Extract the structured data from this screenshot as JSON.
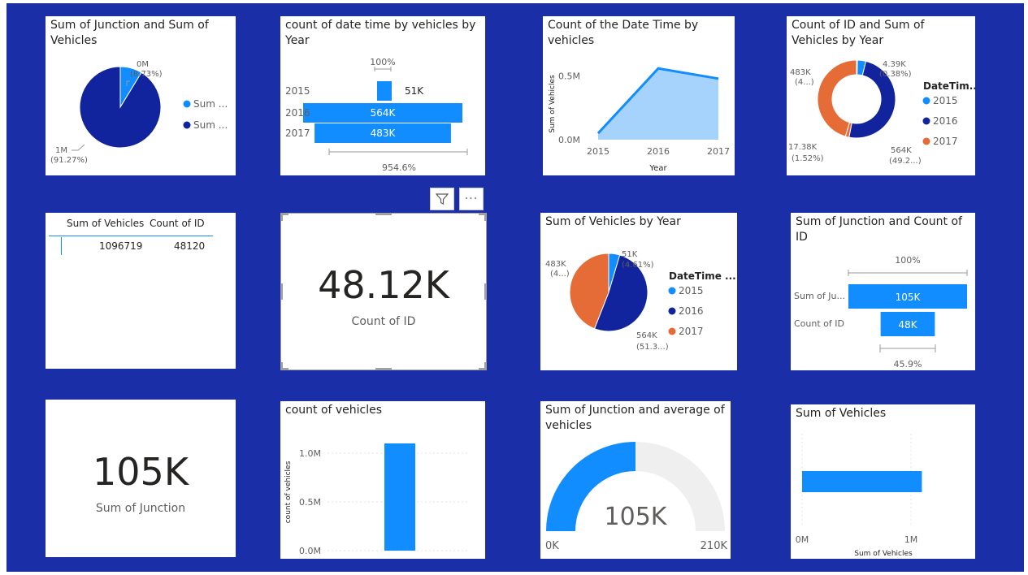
{
  "colors": {
    "canvas": "#1a2ea8",
    "light_blue": "#118dff",
    "dark_blue": "#12239e",
    "orange": "#e66c37",
    "area_fill": "#a6d3fb",
    "gauge_bg": "#efefef",
    "text": "#252423",
    "muted": "#605e5c"
  },
  "icons": {
    "filter": "filter-icon",
    "more": "more-options-icon"
  },
  "tiles": {
    "pie_junction_vehicles": {
      "title": "Sum of Junction and Sum of Vehicles"
    },
    "funnel_year": {
      "title": "count of date time by vehicles by Year"
    },
    "area_datetime": {
      "title": "Count of the Date Time by vehicles"
    },
    "donut_id_vehicles": {
      "title": "Count of ID and Sum of Vehicles by Year"
    },
    "table": {
      "columns": [
        "Sum of Vehicles",
        "Count of ID"
      ],
      "rows": [
        [
          "1096719",
          "48120"
        ]
      ]
    },
    "card_id": {
      "value": "48.12K",
      "label": "Count of ID",
      "more": "···"
    },
    "pie_year": {
      "title": "Sum of Vehicles by Year"
    },
    "funnel_junction_id": {
      "title": "Sum of Junction and Count of ID"
    },
    "card_junction": {
      "value": "105K",
      "label": "Sum of Junction"
    },
    "column_vehicles": {
      "title": "count of vehicles"
    },
    "gauge": {
      "title": "Sum of Junction and average of vehicles"
    },
    "bar_vehicles": {
      "title": "Sum of Vehicles"
    }
  },
  "chart_data": [
    {
      "id": "pie_junction_vehicles",
      "type": "pie",
      "title": "Sum of Junction and Sum of Vehicles",
      "legend_position": "right",
      "legend": [
        "Sum ...",
        "Sum ..."
      ],
      "slices": [
        {
          "value_label": "0M",
          "pct_label": "(8.73%)",
          "fraction": 0.0873,
          "color": "#118dff"
        },
        {
          "value_label": "1M",
          "pct_label": "(91.27%)",
          "fraction": 0.9127,
          "color": "#12239e"
        }
      ]
    },
    {
      "id": "funnel_year",
      "type": "bar",
      "title": "count of date time by vehicles by Year",
      "categories": [
        "2015",
        "2016",
        "2017"
      ],
      "values": [
        51,
        564,
        483
      ],
      "value_labels": [
        "51K",
        "564K",
        "483K"
      ],
      "top_label": "100%",
      "bottom_label": "954.6%",
      "color": "#118dff"
    },
    {
      "id": "area_datetime",
      "type": "area",
      "title": "Count of the Date Time by vehicles",
      "x": [
        "2015",
        "2016",
        "2017"
      ],
      "y": [
        0.05,
        0.56,
        0.48
      ],
      "xlabel": "Year",
      "ylabel": "Sum of Vehicles",
      "y_ticks": [
        "0.0M",
        "0.5M"
      ],
      "y_tick_values": [
        0,
        0.5
      ],
      "ylim": [
        0,
        0.6
      ],
      "grid": false
    },
    {
      "id": "donut_id_vehicles",
      "type": "pie",
      "title": "Count of ID and Sum of Vehicles by Year",
      "legend_title": "DateTim...",
      "legend_position": "right",
      "legend": [
        "2015",
        "2016",
        "2017"
      ],
      "slices": [
        {
          "value_label": "4.39K",
          "pct_label": "(0.38%)",
          "fraction": 0.0038,
          "color": "#118dff"
        },
        {
          "value_label": "",
          "pct_label": "",
          "fraction": 0.035,
          "color": "#118dff"
        },
        {
          "value_label": "564K",
          "pct_label": "(49.2...)",
          "fraction": 0.4922,
          "color": "#12239e"
        },
        {
          "value_label": "17.38K",
          "pct_label": "(1.52%)",
          "fraction": 0.0152,
          "color": "#e66c37"
        },
        {
          "value_label": "483K",
          "pct_label": "(4...)",
          "fraction": 0.4538,
          "color": "#e66c37"
        }
      ]
    },
    {
      "id": "pie_year",
      "type": "pie",
      "title": "Sum of Vehicles by Year",
      "legend_title": "DateTime ...",
      "legend_position": "right",
      "legend": [
        "2015",
        "2016",
        "2017"
      ],
      "slices": [
        {
          "value_label": "51K",
          "pct_label": "(4.61%)",
          "fraction": 0.0461,
          "color": "#118dff"
        },
        {
          "value_label": "564K",
          "pct_label": "(51.3...)",
          "fraction": 0.5132,
          "color": "#12239e"
        },
        {
          "value_label": "483K",
          "pct_label": "(4...)",
          "fraction": 0.4407,
          "color": "#e66c37"
        }
      ]
    },
    {
      "id": "funnel_junction_id",
      "type": "bar",
      "title": "Sum of Junction and Count of ID",
      "categories": [
        "Sum of Ju...",
        "Count of ID"
      ],
      "values": [
        105,
        48
      ],
      "value_labels": [
        "105K",
        "48K"
      ],
      "top_label": "100%",
      "bottom_label": "45.9%",
      "color": "#118dff"
    },
    {
      "id": "column_vehicles",
      "type": "bar",
      "title": "count of vehicles",
      "values": [
        1.1
      ],
      "ylabel": "count of vehicles",
      "y_ticks": [
        "0.0M",
        "0.5M",
        "1.0M"
      ],
      "y_tick_values": [
        0,
        0.5,
        1.0
      ],
      "ylim": [
        0,
        1.2
      ],
      "grid": true,
      "color": "#118dff"
    },
    {
      "id": "gauge",
      "type": "gauge",
      "title": "Sum of Junction and average of vehicles",
      "value": 105,
      "min": 0,
      "max": 210,
      "value_label": "105K",
      "min_label": "0K",
      "max_label": "210K",
      "color": "#118dff"
    },
    {
      "id": "bar_vehicles",
      "type": "bar",
      "title": "Sum of Vehicles",
      "values": [
        1.1
      ],
      "xlabel": "Sum of Vehicles",
      "x_ticks": [
        "0M",
        "1M"
      ],
      "x_tick_values": [
        0,
        1
      ],
      "xlim": [
        0,
        1.0
      ],
      "color": "#118dff"
    }
  ]
}
